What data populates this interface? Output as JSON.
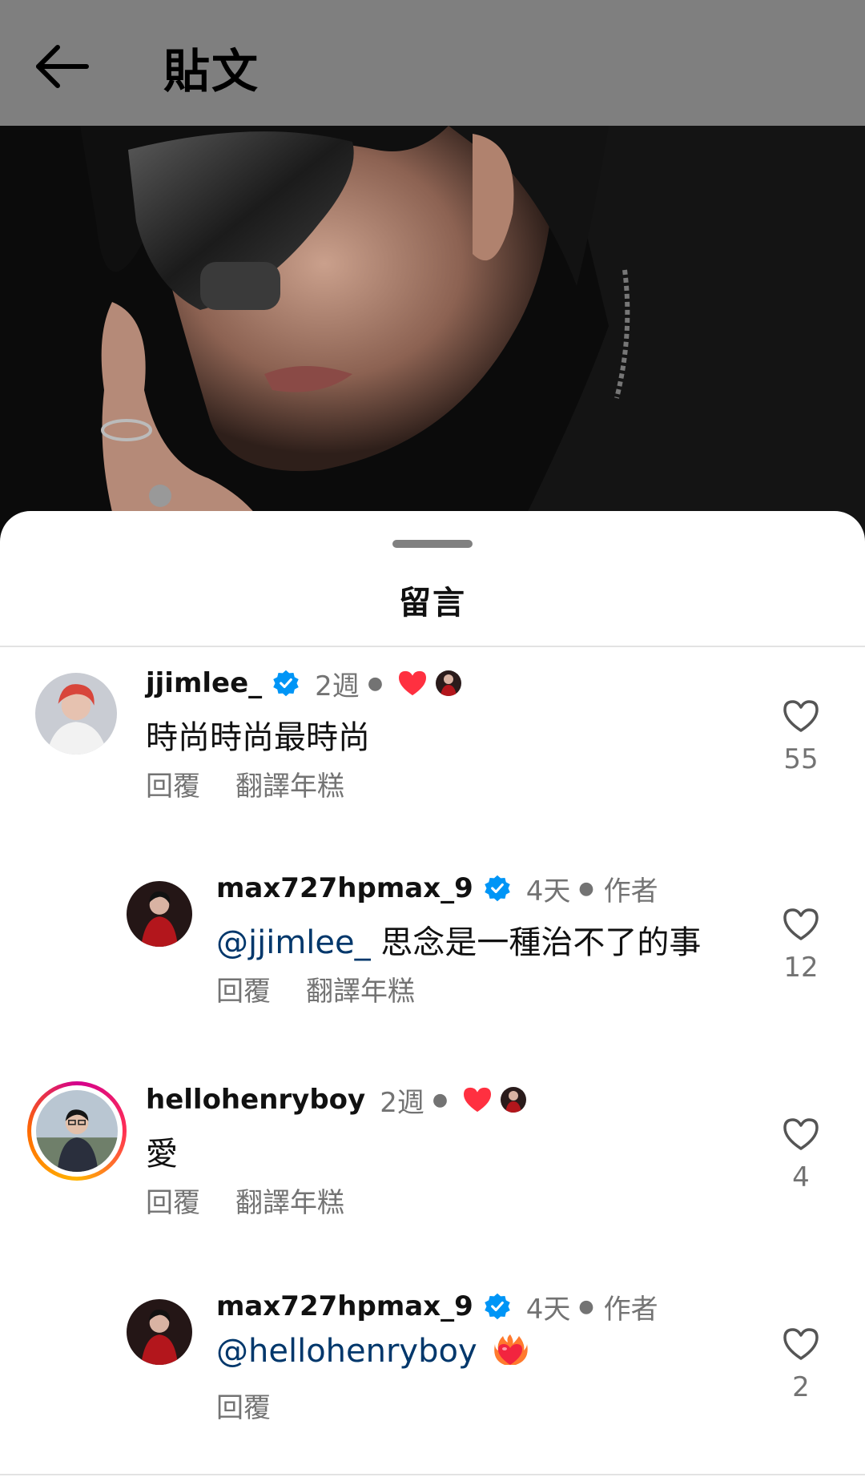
{
  "header": {
    "title": "貼文",
    "back_icon": "arrow-left-icon"
  },
  "sheet": {
    "title": "留言"
  },
  "colors": {
    "topbar_bg": "#7f7f7f",
    "verified_blue": "#0095f6",
    "like_red": "#ff3040",
    "mention_blue": "#00376b",
    "muted_text": "#737373"
  },
  "comments": [
    {
      "username": "jjimlee_",
      "verified": true,
      "time": "2週",
      "liked_by_author": true,
      "is_author": false,
      "mention": "",
      "text": "時尚時尚最時尚",
      "reply_label": "回覆",
      "translate_label": "翻譯年糕",
      "likes": "55"
    },
    {
      "username": "max727hpmax_9",
      "verified": true,
      "time": "4天",
      "author_label": "作者",
      "is_author": true,
      "mention": "@jjimlee_",
      "text": "思念是一種治不了的事",
      "reply_label": "回覆",
      "translate_label": "翻譯年糕",
      "likes": "12"
    },
    {
      "username": "hellohenryboy",
      "verified": false,
      "time": "2週",
      "liked_by_author": true,
      "is_author": false,
      "mention": "",
      "text": "愛",
      "reply_label": "回覆",
      "translate_label": "翻譯年糕",
      "likes": "4"
    },
    {
      "username": "max727hpmax_9",
      "verified": true,
      "time": "4天",
      "author_label": "作者",
      "is_author": true,
      "mention": "@hellohenryboy",
      "emoji": "heart-on-fire-icon",
      "reply_label": "回覆",
      "likes": "2"
    }
  ]
}
